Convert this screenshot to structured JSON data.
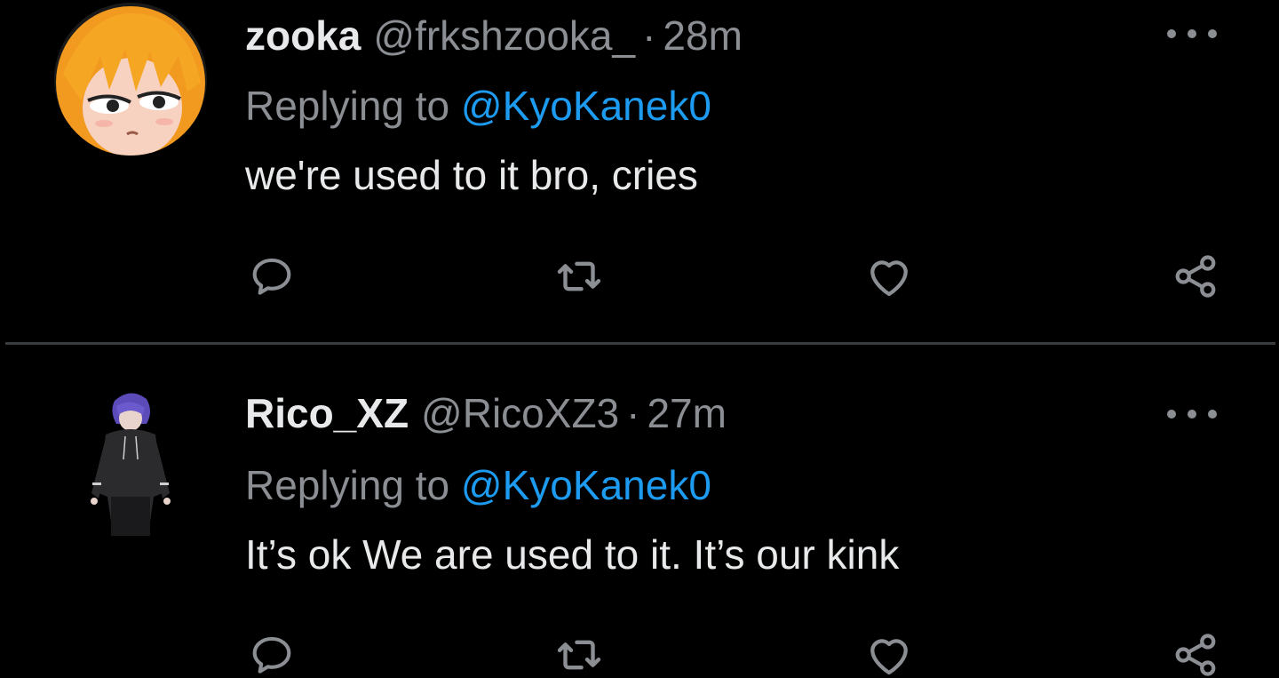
{
  "tweets": [
    {
      "display_name": "zooka",
      "handle": "@frkshzooka_",
      "separator": "·",
      "time": "28m",
      "replying_prefix": "Replying to",
      "replying_to": "@KyoKanek0",
      "text": "we're used to it bro, cries"
    },
    {
      "display_name": "Rico_XZ",
      "handle": "@RicoXZ3",
      "separator": "·",
      "time": "27m",
      "replying_prefix": "Replying to",
      "replying_to": "@KyoKanek0",
      "text": "It’s ok We are used to it. It’s our kink"
    }
  ],
  "icons": {
    "reply": "reply-icon",
    "retweet": "retweet-icon",
    "like": "heart-icon",
    "share": "share-icon",
    "more": "more-options-icon"
  },
  "colors": {
    "background": "#000000",
    "primary_text": "#e7e9ea",
    "secondary_text": "#8b8f94",
    "mention": "#1d9bf0",
    "divider": "#3a3d40"
  }
}
